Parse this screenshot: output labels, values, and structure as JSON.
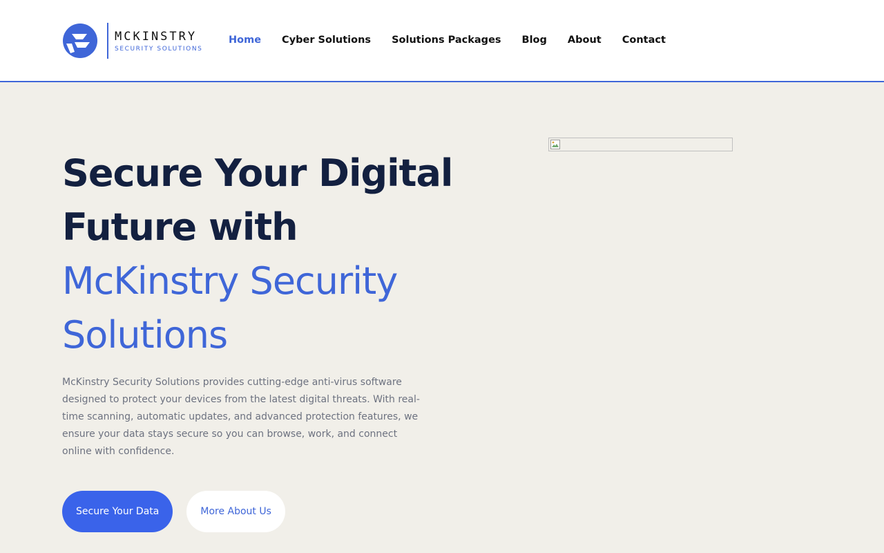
{
  "brand": {
    "name": "MCKINSTRY",
    "tagline": "SECURITY SOLUTIONS",
    "accent_color": "#3f66d8"
  },
  "nav": {
    "items": [
      {
        "label": "Home",
        "active": true
      },
      {
        "label": "Cyber Solutions",
        "active": false
      },
      {
        "label": "Solutions Packages",
        "active": false
      },
      {
        "label": "Blog",
        "active": false
      },
      {
        "label": "About",
        "active": false
      },
      {
        "label": "Contact",
        "active": false
      }
    ]
  },
  "hero": {
    "title_line1": "Secure Your Digital",
    "title_line2": "Future with",
    "title_accent_line1": "McKinstry Security",
    "title_accent_line2": "Solutions",
    "description": "McKinstry Security Solutions provides cutting-edge anti-virus software designed to protect your devices from the latest digital threats. With real-time scanning, automatic updates, and advanced protection features, we ensure your data stays secure so you can browse, work, and connect online with confidence.",
    "primary_button": "Secure Your Data",
    "secondary_button": "More About Us",
    "primary_color": "#3a63ea",
    "heading_color": "#132040",
    "image_icon": "broken-image-icon"
  }
}
